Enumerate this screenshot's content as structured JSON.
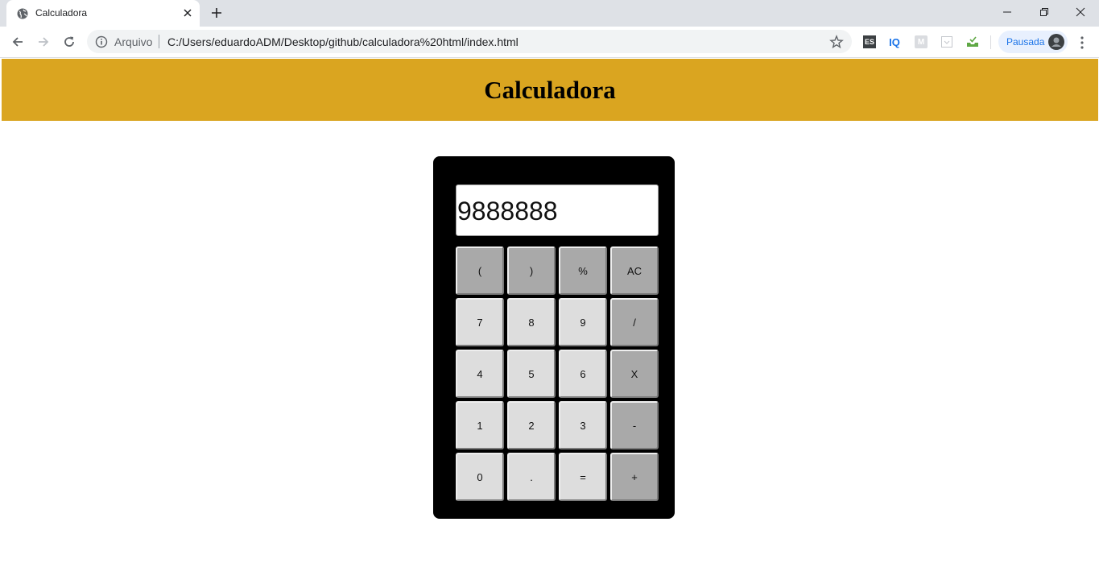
{
  "browser": {
    "tab_title": "Calculadora",
    "scheme_label": "Arquivo",
    "url": "C:/Users/eduardoADM/Desktop/github/calculadora%20html/index.html",
    "profile_label": "Pausada",
    "extensions": [
      "ES",
      "IQ",
      "M",
      "",
      ""
    ]
  },
  "page": {
    "title": "Calculadora",
    "header_color": "#daa520"
  },
  "calculator": {
    "display_value": "9888888",
    "keys": [
      {
        "label": "(",
        "style": "dark"
      },
      {
        "label": ")",
        "style": "dark"
      },
      {
        "label": "%",
        "style": "dark"
      },
      {
        "label": "AC",
        "style": "dark"
      },
      {
        "label": "7",
        "style": "light"
      },
      {
        "label": "8",
        "style": "light"
      },
      {
        "label": "9",
        "style": "light"
      },
      {
        "label": "/",
        "style": "dark"
      },
      {
        "label": "4",
        "style": "light"
      },
      {
        "label": "5",
        "style": "light"
      },
      {
        "label": "6",
        "style": "light"
      },
      {
        "label": "X",
        "style": "dark"
      },
      {
        "label": "1",
        "style": "light"
      },
      {
        "label": "2",
        "style": "light"
      },
      {
        "label": "3",
        "style": "light"
      },
      {
        "label": "-",
        "style": "dark"
      },
      {
        "label": "0",
        "style": "light"
      },
      {
        "label": ".",
        "style": "light"
      },
      {
        "label": "=",
        "style": "light"
      },
      {
        "label": "+",
        "style": "dark"
      }
    ]
  }
}
